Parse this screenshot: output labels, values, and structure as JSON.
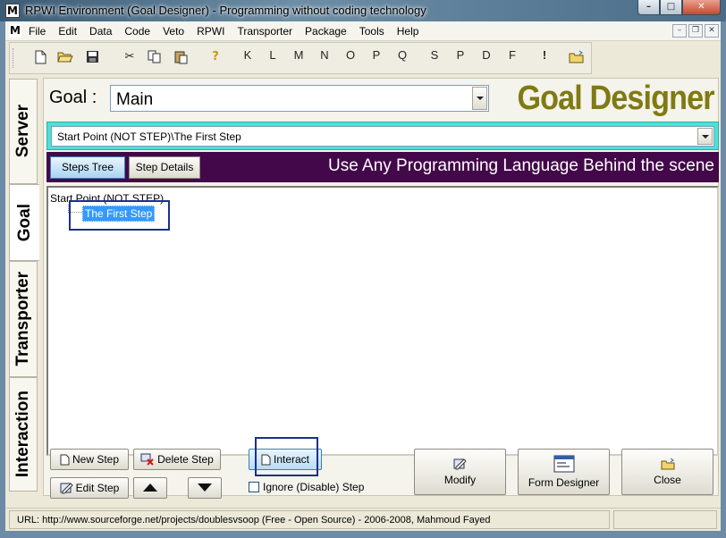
{
  "window": {
    "title": "RPWI Environment (Goal Designer) - Programming without coding technology",
    "app_icon": "M",
    "caption_buttons": [
      "minimize",
      "maximize",
      "close"
    ]
  },
  "menu": {
    "icon": "M",
    "items": [
      "File",
      "Edit",
      "Data",
      "Code",
      "Veto",
      "RPWI",
      "Transporter",
      "Package",
      "Tools",
      "Help"
    ]
  },
  "toolbar": {
    "icons": [
      "new-file-icon",
      "open-folder-icon",
      "save-icon",
      "cut-icon",
      "copy-icon",
      "paste-icon",
      "help-icon"
    ],
    "letters": [
      "K",
      "L",
      "M",
      "N",
      "O",
      "P",
      "Q",
      "S",
      "P",
      "D",
      "F"
    ],
    "bang": "!",
    "last_icon": "open-folder-arrow-icon"
  },
  "side_tabs": [
    "Server",
    "Goal",
    "Transporter",
    "Interaction"
  ],
  "goal": {
    "label": "Goal :",
    "value": "Main",
    "designer_title": "Goal Designer"
  },
  "path": {
    "value": "Start Point (NOT STEP)\\The First Step"
  },
  "tabs": {
    "steps_tree": "Steps Tree",
    "step_details": "Step Details",
    "active": "Steps Tree",
    "tagline": "Use Any Programming Language Behind the scene"
  },
  "tree": {
    "root": "Start Point (NOT STEP)",
    "child": "The First Step"
  },
  "buttons": {
    "new_step": "New Step",
    "delete_step": "Delete Step",
    "edit_step": "Edit Step",
    "interact": "Interact",
    "modify": "Modify",
    "form_designer": "Form Designer",
    "close": "Close",
    "ignore_label": "Ignore (Disable) Step",
    "ignore_checked": false
  },
  "status": {
    "text": "URL: http://www.sourceforge.net/projects/doublesvsoop (Free - Open Source) - 2006-2008, Mahmoud Fayed"
  },
  "colors": {
    "designer_title": "#7f7a12",
    "path_bar": "#4ce1d6",
    "tab_strip": "#43084a",
    "selection": "#3399ff",
    "highlight_box": "#1d2f8d"
  }
}
